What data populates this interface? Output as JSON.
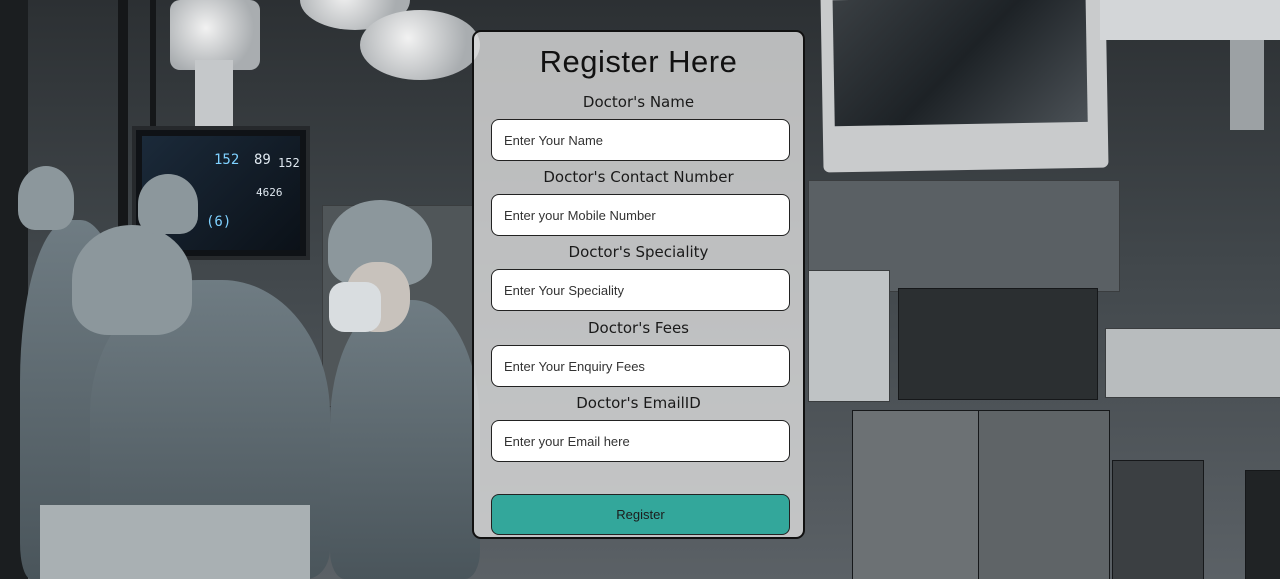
{
  "form": {
    "title": "Register Here",
    "fields": [
      {
        "label": "Doctor's Name",
        "placeholder": "Enter Your Name",
        "value": ""
      },
      {
        "label": "Doctor's Contact Number",
        "placeholder": "Enter your Mobile Number",
        "value": ""
      },
      {
        "label": "Doctor's Speciality",
        "placeholder": "Enter Your Speciality",
        "value": ""
      },
      {
        "label": "Doctor's Fees",
        "placeholder": "Enter Your Enquiry Fees",
        "value": ""
      },
      {
        "label": "Doctor's EmailID",
        "placeholder": "Enter your Email here",
        "value": ""
      }
    ],
    "submit_label": "Register"
  },
  "background": {
    "monitor_readouts": [
      "152",
      "89",
      "152",
      "4626",
      "(6)"
    ],
    "accent_color": "#33a79b"
  }
}
